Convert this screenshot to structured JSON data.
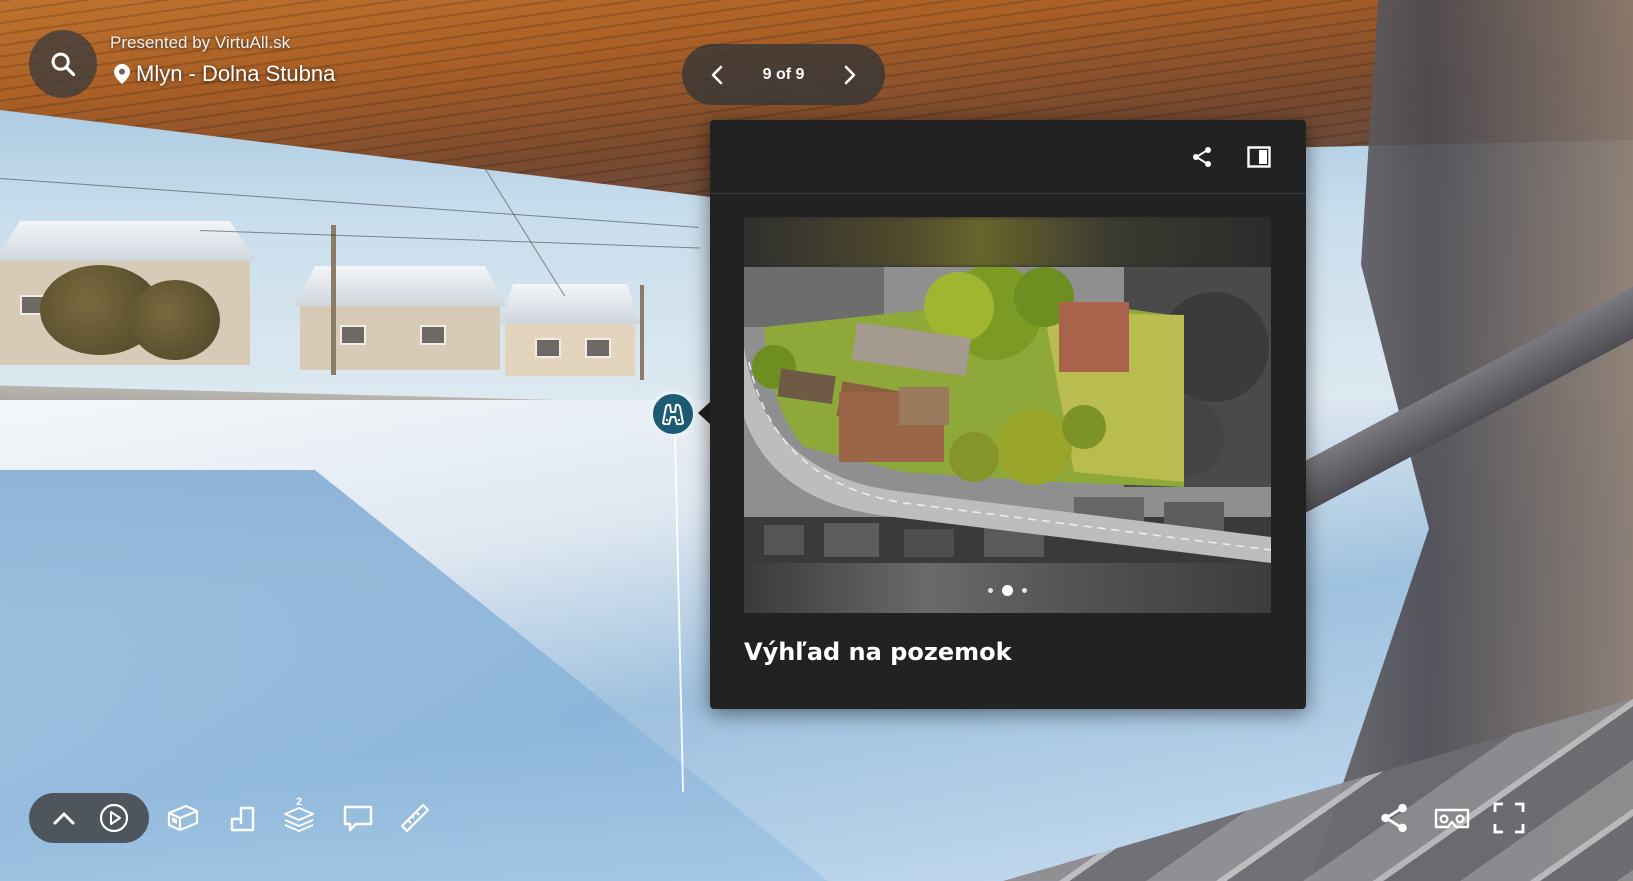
{
  "branding": {
    "presented_by": "Presented by VirtuAll.sk",
    "location": "Mlyn - Dolna Stubna"
  },
  "pager": {
    "count": "9 of 9"
  },
  "tag_card": {
    "title": "Výhľad na pozemok",
    "carousel": {
      "total": 3,
      "active_index": 2
    }
  },
  "toolbar": {
    "floor_badge": "2"
  },
  "icons": {
    "top_left": [
      "search-icon",
      "map-pin-icon"
    ],
    "pager": [
      "chevron-left-icon",
      "chevron-right-icon"
    ],
    "card_header": [
      "share-icon",
      "sidebar-panel-icon"
    ],
    "tag": "binoculars-icon",
    "bottom_left": [
      "chevron-up-icon",
      "play-icon",
      "dollhouse-icon",
      "floorplan-icon",
      "floors-icon",
      "mattertag-comment-icon",
      "measure-ruler-icon"
    ],
    "bottom_right": [
      "share-icon",
      "vr-headset-icon",
      "fullscreen-icon"
    ]
  },
  "colors": {
    "card_bg": "#222222",
    "tag_marker": "#1d5b75",
    "control_bg": "rgba(60,60,60,0.8)"
  }
}
